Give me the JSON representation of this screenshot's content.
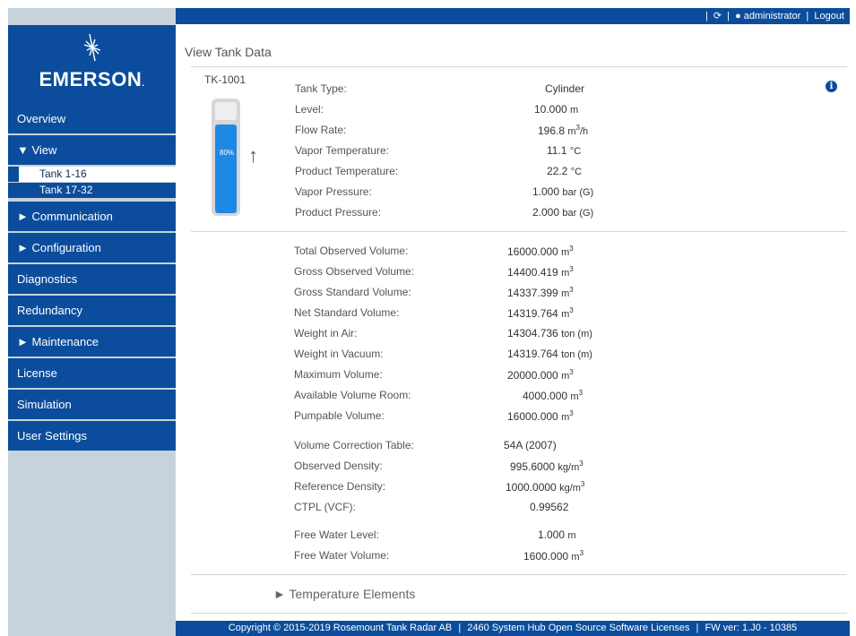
{
  "topbar": {
    "separator1": "|",
    "refresh_icon": "refresh-icon",
    "separator2": "|",
    "user_icon": "user-icon",
    "user": "administrator",
    "separator3": "|",
    "logout": "Logout"
  },
  "brand": {
    "name": "EMERSON",
    "dot": "."
  },
  "nav": {
    "overview": "Overview",
    "view": "▼ View",
    "tank_1_16": "Tank 1-16",
    "tank_17_32": "Tank 17-32",
    "communication": "► Communication",
    "configuration": "► Configuration",
    "diagnostics": "Diagnostics",
    "redundancy": "Redundancy",
    "maintenance": "► Maintenance",
    "license": "License",
    "simulation": "Simulation",
    "user_settings": "User Settings"
  },
  "page": {
    "title": "View Tank Data",
    "tank_id": "TK-1001",
    "info_icon": "info-icon"
  },
  "tank": {
    "level_percent": 80,
    "level_label": "80%",
    "arrow": "↑"
  },
  "props": [
    {
      "label": "Tank Type:",
      "value": "Cylinder",
      "unit": "",
      "sup": ""
    },
    {
      "label": "Level:",
      "value": "10.000",
      "unit": "m",
      "sup": ""
    },
    {
      "label": "Flow Rate:",
      "value": "196.8",
      "unit": "m",
      "sup": "3",
      "unit2": "/h"
    },
    {
      "label": "Vapor Temperature:",
      "value": "11.1",
      "unit": "°C",
      "sup": ""
    },
    {
      "label": "Product Temperature:",
      "value": "22.2",
      "unit": "°C",
      "sup": ""
    },
    {
      "label": "Vapor Pressure:",
      "value": "1.000",
      "unit": "bar (G)",
      "sup": ""
    },
    {
      "label": "Product Pressure:",
      "value": "2.000",
      "unit": "bar (G)",
      "sup": ""
    }
  ],
  "volumes": [
    {
      "label": "Total Observed Volume:",
      "value": "16000.000",
      "unit": "m",
      "sup": "3"
    },
    {
      "label": "Gross Observed Volume:",
      "value": "14400.419",
      "unit": "m",
      "sup": "3"
    },
    {
      "label": "Gross Standard Volume:",
      "value": "14337.399",
      "unit": "m",
      "sup": "3"
    },
    {
      "label": "Net Standard Volume:",
      "value": "14319.764",
      "unit": "m",
      "sup": "3"
    },
    {
      "label": "Weight in Air:",
      "value": "14304.736",
      "unit": "ton (m)",
      "sup": ""
    },
    {
      "label": "Weight in Vacuum:",
      "value": "14319.764",
      "unit": "ton (m)",
      "sup": ""
    },
    {
      "label": "Maximum Volume:",
      "value": "20000.000",
      "unit": "m",
      "sup": "3"
    },
    {
      "label": "Available Volume Room:",
      "value": "4000.000",
      "unit": "m",
      "sup": "3"
    },
    {
      "label": "Pumpable Volume:",
      "value": "16000.000",
      "unit": "m",
      "sup": "3"
    },
    {
      "label": "Volume Correction Table:",
      "value": "54A (2007)",
      "unit": "",
      "sup": ""
    },
    {
      "label": "Observed Density:",
      "value": "995.6000",
      "unit": "kg/m",
      "sup": "3"
    },
    {
      "label": "Reference Density:",
      "value": "1000.0000",
      "unit": "kg/m",
      "sup": "3"
    },
    {
      "label": "CTPL (VCF):",
      "value": "0.99562",
      "unit": "",
      "sup": ""
    },
    {
      "label": "Free Water Level:",
      "value": "1.000",
      "unit": "m",
      "sup": ""
    },
    {
      "label": "Free Water Volume:",
      "value": "1600.000",
      "unit": "m",
      "sup": "3"
    }
  ],
  "temperature_elements": "► Temperature Elements",
  "footer": {
    "copyright": "Copyright © 2015-2019 Rosemount Tank Radar AB",
    "sep1": "|",
    "licenses": "2460 System Hub Open Source Software Licenses",
    "sep2": "|",
    "fw": "FW ver: 1.J0 - 10385"
  }
}
